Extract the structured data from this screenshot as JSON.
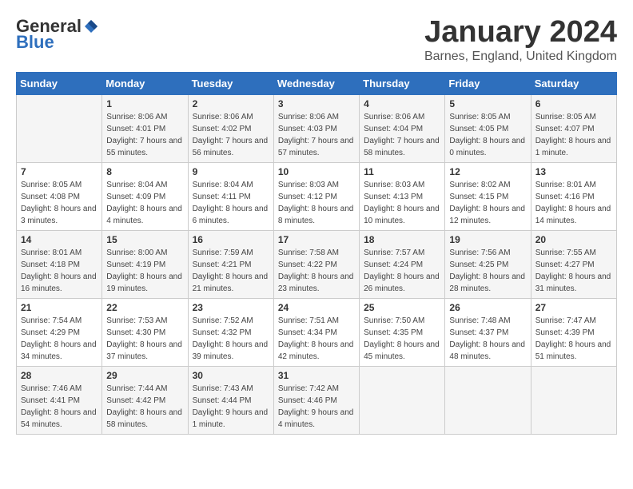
{
  "logo": {
    "general": "General",
    "blue": "Blue"
  },
  "title": "January 2024",
  "subtitle": "Barnes, England, United Kingdom",
  "days_of_week": [
    "Sunday",
    "Monday",
    "Tuesday",
    "Wednesday",
    "Thursday",
    "Friday",
    "Saturday"
  ],
  "weeks": [
    [
      {
        "day": "",
        "sunrise": "",
        "sunset": "",
        "daylight": ""
      },
      {
        "day": "1",
        "sunrise": "Sunrise: 8:06 AM",
        "sunset": "Sunset: 4:01 PM",
        "daylight": "Daylight: 7 hours and 55 minutes."
      },
      {
        "day": "2",
        "sunrise": "Sunrise: 8:06 AM",
        "sunset": "Sunset: 4:02 PM",
        "daylight": "Daylight: 7 hours and 56 minutes."
      },
      {
        "day": "3",
        "sunrise": "Sunrise: 8:06 AM",
        "sunset": "Sunset: 4:03 PM",
        "daylight": "Daylight: 7 hours and 57 minutes."
      },
      {
        "day": "4",
        "sunrise": "Sunrise: 8:06 AM",
        "sunset": "Sunset: 4:04 PM",
        "daylight": "Daylight: 7 hours and 58 minutes."
      },
      {
        "day": "5",
        "sunrise": "Sunrise: 8:05 AM",
        "sunset": "Sunset: 4:05 PM",
        "daylight": "Daylight: 8 hours and 0 minutes."
      },
      {
        "day": "6",
        "sunrise": "Sunrise: 8:05 AM",
        "sunset": "Sunset: 4:07 PM",
        "daylight": "Daylight: 8 hours and 1 minute."
      }
    ],
    [
      {
        "day": "7",
        "sunrise": "Sunrise: 8:05 AM",
        "sunset": "Sunset: 4:08 PM",
        "daylight": "Daylight: 8 hours and 3 minutes."
      },
      {
        "day": "8",
        "sunrise": "Sunrise: 8:04 AM",
        "sunset": "Sunset: 4:09 PM",
        "daylight": "Daylight: 8 hours and 4 minutes."
      },
      {
        "day": "9",
        "sunrise": "Sunrise: 8:04 AM",
        "sunset": "Sunset: 4:11 PM",
        "daylight": "Daylight: 8 hours and 6 minutes."
      },
      {
        "day": "10",
        "sunrise": "Sunrise: 8:03 AM",
        "sunset": "Sunset: 4:12 PM",
        "daylight": "Daylight: 8 hours and 8 minutes."
      },
      {
        "day": "11",
        "sunrise": "Sunrise: 8:03 AM",
        "sunset": "Sunset: 4:13 PM",
        "daylight": "Daylight: 8 hours and 10 minutes."
      },
      {
        "day": "12",
        "sunrise": "Sunrise: 8:02 AM",
        "sunset": "Sunset: 4:15 PM",
        "daylight": "Daylight: 8 hours and 12 minutes."
      },
      {
        "day": "13",
        "sunrise": "Sunrise: 8:01 AM",
        "sunset": "Sunset: 4:16 PM",
        "daylight": "Daylight: 8 hours and 14 minutes."
      }
    ],
    [
      {
        "day": "14",
        "sunrise": "Sunrise: 8:01 AM",
        "sunset": "Sunset: 4:18 PM",
        "daylight": "Daylight: 8 hours and 16 minutes."
      },
      {
        "day": "15",
        "sunrise": "Sunrise: 8:00 AM",
        "sunset": "Sunset: 4:19 PM",
        "daylight": "Daylight: 8 hours and 19 minutes."
      },
      {
        "day": "16",
        "sunrise": "Sunrise: 7:59 AM",
        "sunset": "Sunset: 4:21 PM",
        "daylight": "Daylight: 8 hours and 21 minutes."
      },
      {
        "day": "17",
        "sunrise": "Sunrise: 7:58 AM",
        "sunset": "Sunset: 4:22 PM",
        "daylight": "Daylight: 8 hours and 23 minutes."
      },
      {
        "day": "18",
        "sunrise": "Sunrise: 7:57 AM",
        "sunset": "Sunset: 4:24 PM",
        "daylight": "Daylight: 8 hours and 26 minutes."
      },
      {
        "day": "19",
        "sunrise": "Sunrise: 7:56 AM",
        "sunset": "Sunset: 4:25 PM",
        "daylight": "Daylight: 8 hours and 28 minutes."
      },
      {
        "day": "20",
        "sunrise": "Sunrise: 7:55 AM",
        "sunset": "Sunset: 4:27 PM",
        "daylight": "Daylight: 8 hours and 31 minutes."
      }
    ],
    [
      {
        "day": "21",
        "sunrise": "Sunrise: 7:54 AM",
        "sunset": "Sunset: 4:29 PM",
        "daylight": "Daylight: 8 hours and 34 minutes."
      },
      {
        "day": "22",
        "sunrise": "Sunrise: 7:53 AM",
        "sunset": "Sunset: 4:30 PM",
        "daylight": "Daylight: 8 hours and 37 minutes."
      },
      {
        "day": "23",
        "sunrise": "Sunrise: 7:52 AM",
        "sunset": "Sunset: 4:32 PM",
        "daylight": "Daylight: 8 hours and 39 minutes."
      },
      {
        "day": "24",
        "sunrise": "Sunrise: 7:51 AM",
        "sunset": "Sunset: 4:34 PM",
        "daylight": "Daylight: 8 hours and 42 minutes."
      },
      {
        "day": "25",
        "sunrise": "Sunrise: 7:50 AM",
        "sunset": "Sunset: 4:35 PM",
        "daylight": "Daylight: 8 hours and 45 minutes."
      },
      {
        "day": "26",
        "sunrise": "Sunrise: 7:48 AM",
        "sunset": "Sunset: 4:37 PM",
        "daylight": "Daylight: 8 hours and 48 minutes."
      },
      {
        "day": "27",
        "sunrise": "Sunrise: 7:47 AM",
        "sunset": "Sunset: 4:39 PM",
        "daylight": "Daylight: 8 hours and 51 minutes."
      }
    ],
    [
      {
        "day": "28",
        "sunrise": "Sunrise: 7:46 AM",
        "sunset": "Sunset: 4:41 PM",
        "daylight": "Daylight: 8 hours and 54 minutes."
      },
      {
        "day": "29",
        "sunrise": "Sunrise: 7:44 AM",
        "sunset": "Sunset: 4:42 PM",
        "daylight": "Daylight: 8 hours and 58 minutes."
      },
      {
        "day": "30",
        "sunrise": "Sunrise: 7:43 AM",
        "sunset": "Sunset: 4:44 PM",
        "daylight": "Daylight: 9 hours and 1 minute."
      },
      {
        "day": "31",
        "sunrise": "Sunrise: 7:42 AM",
        "sunset": "Sunset: 4:46 PM",
        "daylight": "Daylight: 9 hours and 4 minutes."
      },
      {
        "day": "",
        "sunrise": "",
        "sunset": "",
        "daylight": ""
      },
      {
        "day": "",
        "sunrise": "",
        "sunset": "",
        "daylight": ""
      },
      {
        "day": "",
        "sunrise": "",
        "sunset": "",
        "daylight": ""
      }
    ]
  ]
}
